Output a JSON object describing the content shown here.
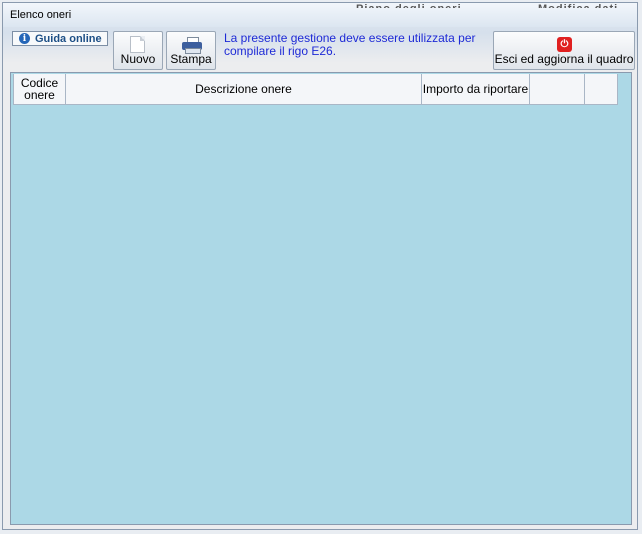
{
  "window": {
    "title": "Elenco oneri",
    "background_title_left": "Piano degli oneri",
    "background_title_right": "Modifica dati"
  },
  "toolbar": {
    "guida_label": "Guida online",
    "nuovo_label": "Nuovo",
    "stampa_label": "Stampa",
    "notice_text": "La presente gestione deve essere utilizzata per compilare il rigo E26.",
    "exit_label": "Esci ed aggiorna il quadro"
  },
  "table": {
    "columns": [
      {
        "label": "Codice onere"
      },
      {
        "label": "Descrizione onere"
      },
      {
        "label": "Importo da riportare"
      },
      {
        "label": ""
      },
      {
        "label": ""
      }
    ],
    "rows": []
  },
  "colors": {
    "grid_background": "#acd8e6",
    "notice_text": "#1e2ad6",
    "exit_icon": "#e02020"
  }
}
